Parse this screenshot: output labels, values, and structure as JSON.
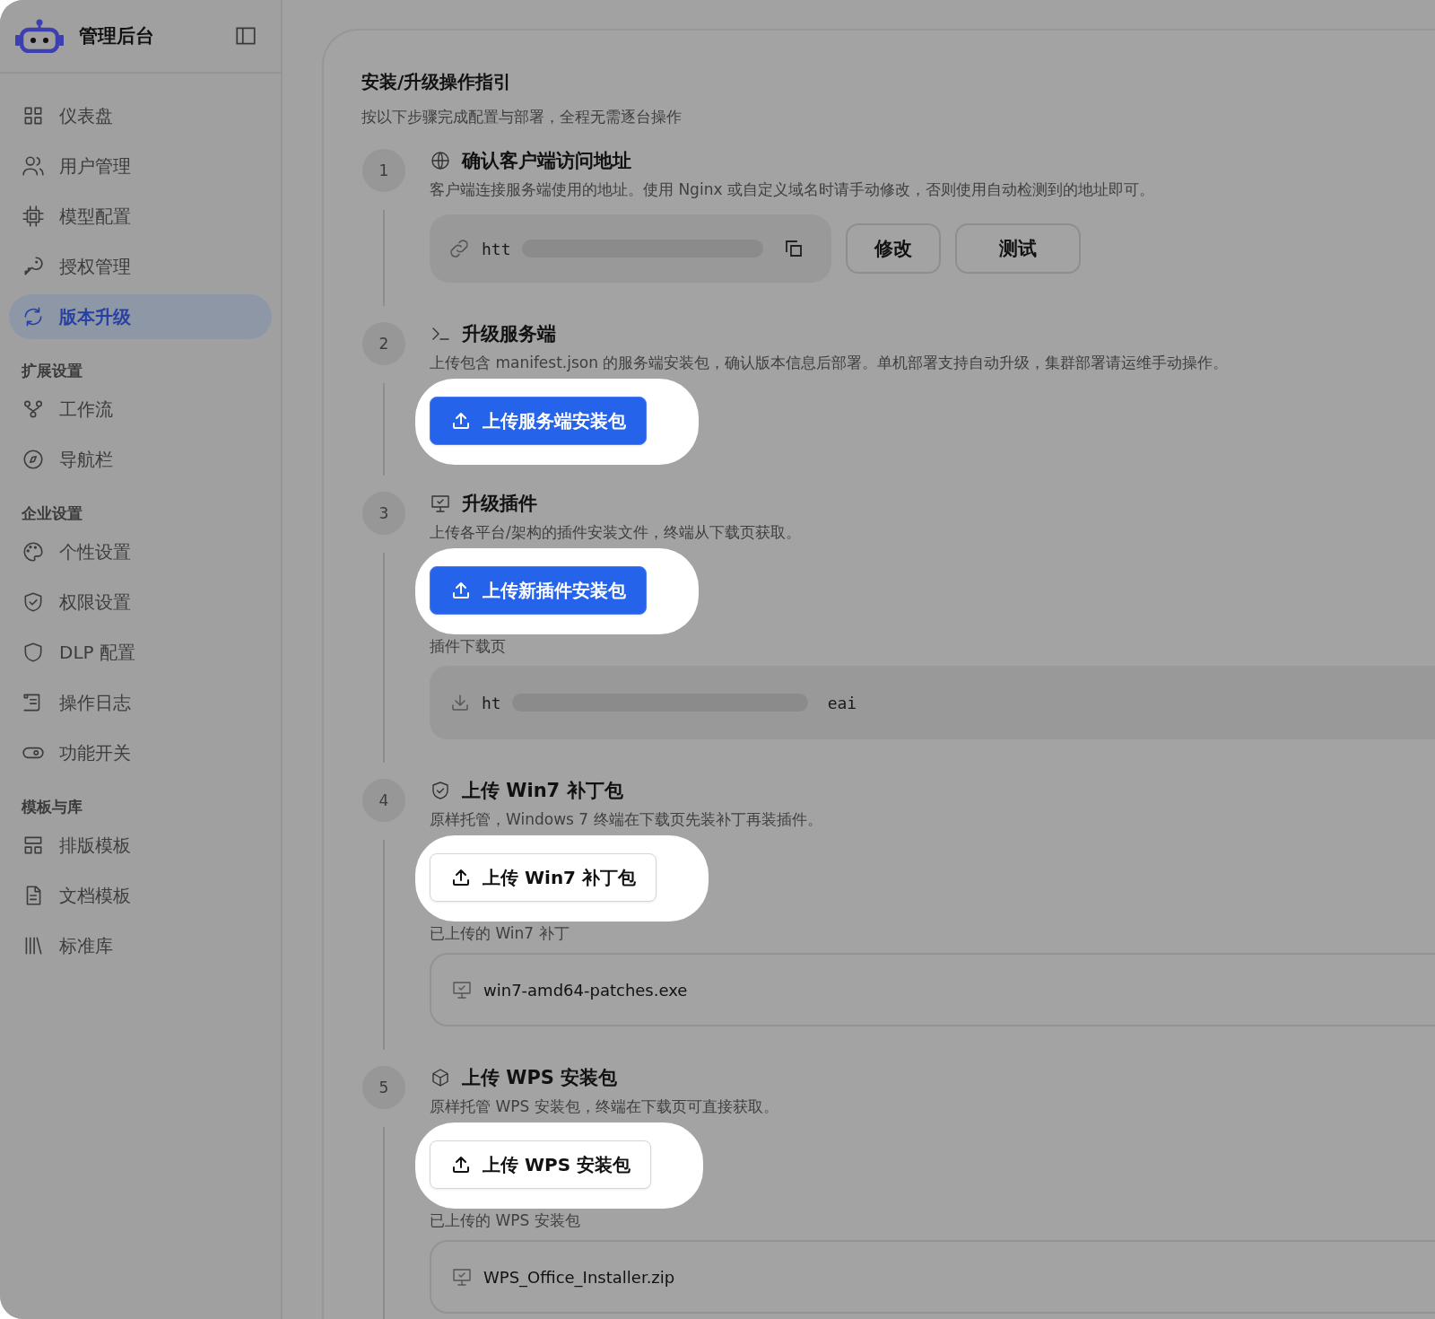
{
  "sidebar": {
    "brand": "管理后台",
    "sections": [
      {
        "items": [
          {
            "label": "仪表盘",
            "selected": false
          },
          {
            "label": "用户管理",
            "selected": false
          },
          {
            "label": "模型配置",
            "selected": false
          },
          {
            "label": "授权管理",
            "selected": false
          },
          {
            "label": "版本升级",
            "selected": true
          }
        ]
      },
      {
        "heading": "扩展设置",
        "items": [
          {
            "label": "工作流",
            "selected": false
          },
          {
            "label": "导航栏",
            "selected": false
          }
        ]
      },
      {
        "heading": "企业设置",
        "items": [
          {
            "label": "个性设置",
            "selected": false
          },
          {
            "label": "权限设置",
            "selected": false
          },
          {
            "label": "DLP 配置",
            "selected": false
          },
          {
            "label": "操作日志",
            "selected": false
          },
          {
            "label": "功能开关",
            "selected": false
          }
        ]
      },
      {
        "heading": "模板与库",
        "items": [
          {
            "label": "排版模板",
            "selected": false
          },
          {
            "label": "文档模板",
            "selected": false
          },
          {
            "label": "标准库",
            "selected": false
          }
        ]
      }
    ]
  },
  "guide": {
    "title": "安装/升级操作指引",
    "subtitle": "按以下步骤完成配置与部署，全程无需逐台操作",
    "steps": [
      {
        "number": "1",
        "title": "确认客户端访问地址",
        "description": "客户端连接服务端使用的地址。使用 Nginx 或自定义域名时请手动修改，否则使用自动检测到的地址即可。",
        "rows": [
          [
            {
              "kind": "url_field",
              "text": "htt"
            },
            {
              "kind": "button",
              "label": "修改"
            },
            {
              "kind": "button",
              "label": "测试"
            }
          ]
        ]
      },
      {
        "number": "2",
        "title": "升级服务端",
        "description": "上传包含 manifest.json 的服务端安装包，确认版本信息后部署。单机部署支持自动升级，集群部署请运维手动操作。",
        "rows": [
          [
            {
              "kind": "upload",
              "label": "上传服务端安装包",
              "primary": true,
              "highlighted": true
            }
          ]
        ]
      },
      {
        "number": "3",
        "title": "升级插件",
        "description": "上传各平台/架构的插件安装文件，终端从下载页获取。",
        "rows": [
          [
            {
              "kind": "upload",
              "label": "上传新插件安装包",
              "primary": true,
              "highlighted": true
            }
          ],
          [
            {
              "kind": "label",
              "text": "插件下载页"
            }
          ],
          [
            {
              "kind": "download_field",
              "text": "ht",
              "tail": "eai"
            }
          ]
        ]
      },
      {
        "number": "4",
        "title": "上传 Win7 补丁包",
        "description": "原样托管，Windows 7 终端在下载页先装补丁再装插件。",
        "rows": [
          [
            {
              "kind": "upload",
              "label": "上传 Win7 补丁包",
              "primary": false,
              "highlighted": true
            }
          ],
          [
            {
              "kind": "label",
              "text": "已上传的 Win7 补丁"
            }
          ],
          [
            {
              "kind": "file",
              "name": "win7-amd64-patches.exe"
            }
          ]
        ]
      },
      {
        "number": "5",
        "title": "上传 WPS 安装包",
        "description": "原样托管 WPS 安装包，终端在下载页可直接获取。",
        "rows": [
          [
            {
              "kind": "upload",
              "label": "上传 WPS 安装包",
              "primary": false,
              "highlighted": true
            }
          ],
          [
            {
              "kind": "label",
              "text": "已上传的 WPS 安装包"
            }
          ],
          [
            {
              "kind": "file",
              "name": "WPS_Office_Installer.zip"
            }
          ]
        ]
      }
    ]
  }
}
